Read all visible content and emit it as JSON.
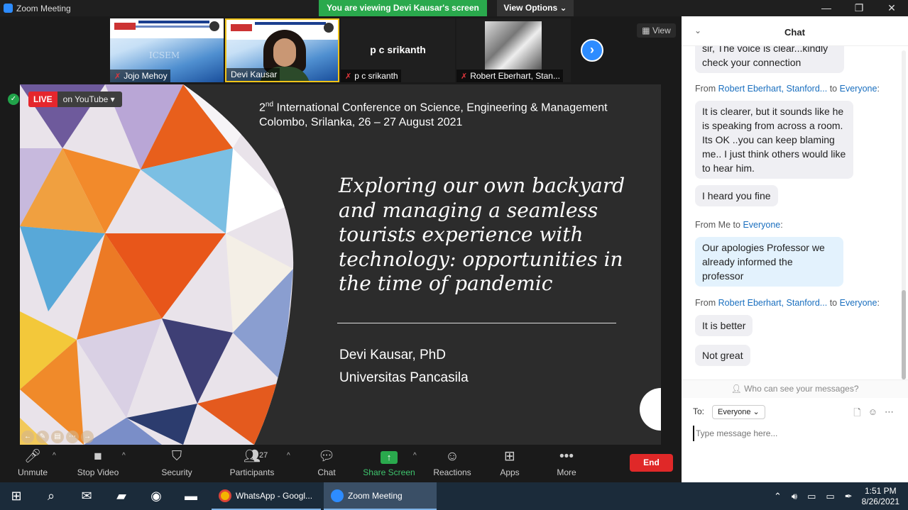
{
  "window": {
    "title": "Zoom Meeting",
    "viewing_banner": "You are viewing Devi Kausar's screen",
    "view_options": "View Options",
    "minimize": "—",
    "restore": "❐",
    "close": "✕"
  },
  "thumbnails": [
    {
      "name": "Jojo Mehoy",
      "muted": true
    },
    {
      "name": "Devi Kausar",
      "muted": false
    },
    {
      "name": "p c srikanth",
      "display": "p c srikanth",
      "muted": true
    },
    {
      "name": "Robert Eberhart, Stan...",
      "muted": true
    }
  ],
  "view_button": "View",
  "shared_screen": {
    "live_label": "LIVE",
    "live_platform": "on YouTube",
    "conference_title_prefix": "2",
    "conference_title_sup": "nd",
    "conference_title_rest": " International Conference on Science, Engineering & Management",
    "conference_location": "Colombo, Srilanka, 26 – 27 August 2021",
    "talk_title": "Exploring our own backyard and managing a seamless tourists experience with technology: opportunities in the time of pandemic",
    "speaker_name": "Devi Kausar, PhD",
    "speaker_affiliation": "Universitas Pancasila"
  },
  "toolbar": {
    "unmute": "Unmute",
    "stop_video": "Stop Video",
    "security": "Security",
    "participants": "Participants",
    "participants_count": "27",
    "chat": "Chat",
    "share_screen": "Share Screen",
    "reactions": "Reactions",
    "apps": "Apps",
    "more": "More",
    "end": "End"
  },
  "chat": {
    "title": "Chat",
    "messages": [
      {
        "type": "bubble",
        "text": "sir, The voice is clear...kindly check your connection"
      },
      {
        "type": "from",
        "from": "Robert Eberhart, Stanford...",
        "to": "Everyone"
      },
      {
        "type": "bubble",
        "text": "It is clearer, but it sounds like he is speaking from across a room.  Its OK ..you can keep blaming me.. I just think others would like to hear him."
      },
      {
        "type": "bubble",
        "text": "I heard you fine"
      },
      {
        "type": "from",
        "from": "Me",
        "to": "Everyone"
      },
      {
        "type": "bubble",
        "text": "Our apologies Professor we already informed the professor"
      },
      {
        "type": "from",
        "from": "Robert Eberhart, Stanford...",
        "to": "Everyone"
      },
      {
        "type": "bubble",
        "text": "It is better"
      },
      {
        "type": "bubble",
        "text": "Not great"
      }
    ],
    "from_label": "From",
    "to_label": "to",
    "who_can_see": "Who can see your messages?",
    "to_field_label": "To:",
    "to_selected": "Everyone",
    "input_placeholder": "Type message here..."
  },
  "taskbar": {
    "apps": [
      {
        "label": "WhatsApp - Googl...",
        "active": false
      },
      {
        "label": "Zoom Meeting",
        "active": true
      }
    ],
    "time": "1:51 PM",
    "date": "8/26/2021"
  }
}
